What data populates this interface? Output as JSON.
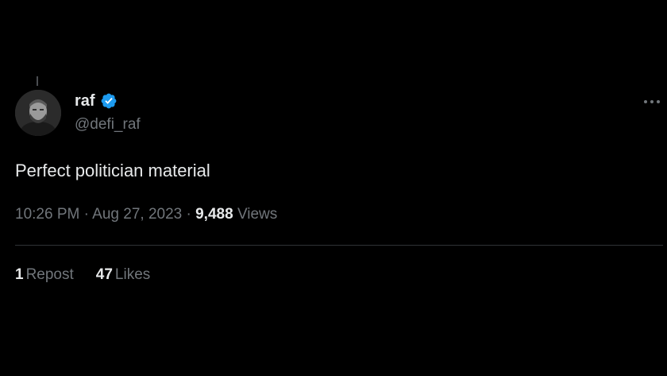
{
  "author": {
    "display_name": "raf",
    "handle": "@defi_raf",
    "verified": true,
    "verified_badge_color": "#1d9bf0"
  },
  "tweet": {
    "text": "Perfect politician material",
    "time": "10:26 PM",
    "separator_1": " · ",
    "date": "Aug 27, 2023",
    "separator_2": " · ",
    "views_count": "9,488",
    "views_label": "Views"
  },
  "stats": {
    "reposts_count": "1",
    "reposts_label": "Repost",
    "likes_count": "47",
    "likes_label": "Likes"
  },
  "icons": {
    "more": "more-horizontal-icon",
    "verified": "verified-badge-icon"
  },
  "colors": {
    "background": "#000000",
    "primary_text": "#e7e9ea",
    "secondary_text": "#71767b",
    "divider": "#2f3336"
  }
}
